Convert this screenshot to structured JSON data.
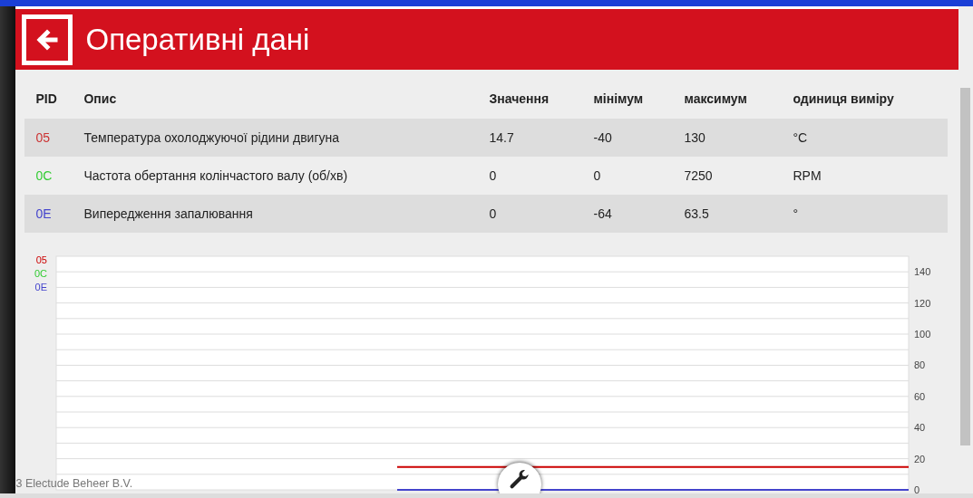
{
  "header": {
    "title": "Оперативні дані"
  },
  "table": {
    "columns": [
      "PID",
      "Опис",
      "Значення",
      "мінімум",
      "максимум",
      "одиниця виміру"
    ],
    "rows": [
      {
        "pid": "05",
        "color": "#cc3333",
        "description": "Температура охолоджуючої рідини двигуна",
        "value": "14.7",
        "min": "-40",
        "max": "130",
        "unit": "°C"
      },
      {
        "pid": "0C",
        "color": "#33cc33",
        "description": "Частота обертання колінчастого валу (об/хв)",
        "value": "0",
        "min": "0",
        "max": "7250",
        "unit": "RPM"
      },
      {
        "pid": "0E",
        "color": "#4444cc",
        "description": "Випередження запалювання",
        "value": "0",
        "min": "-64",
        "max": "63.5",
        "unit": "°"
      }
    ]
  },
  "chart": {
    "chart_data": {
      "type": "line",
      "ylim": [
        0,
        150
      ],
      "yticks": [
        0,
        20,
        40,
        60,
        80,
        100,
        120,
        140
      ],
      "grid": true,
      "series": [
        {
          "name": "05",
          "color": "#cc0000",
          "values": [
            null,
            null,
            14.7,
            14.7,
            14.7,
            14.7
          ]
        },
        {
          "name": "0C",
          "color": "#33cc33",
          "values": [
            null,
            null,
            null,
            null,
            null,
            null
          ]
        },
        {
          "name": "0E",
          "color": "#4444cc",
          "values": [
            null,
            null,
            0,
            0,
            0,
            0
          ]
        }
      ]
    }
  },
  "footer": {
    "copyright": "3 Electude Beheer B.V."
  }
}
